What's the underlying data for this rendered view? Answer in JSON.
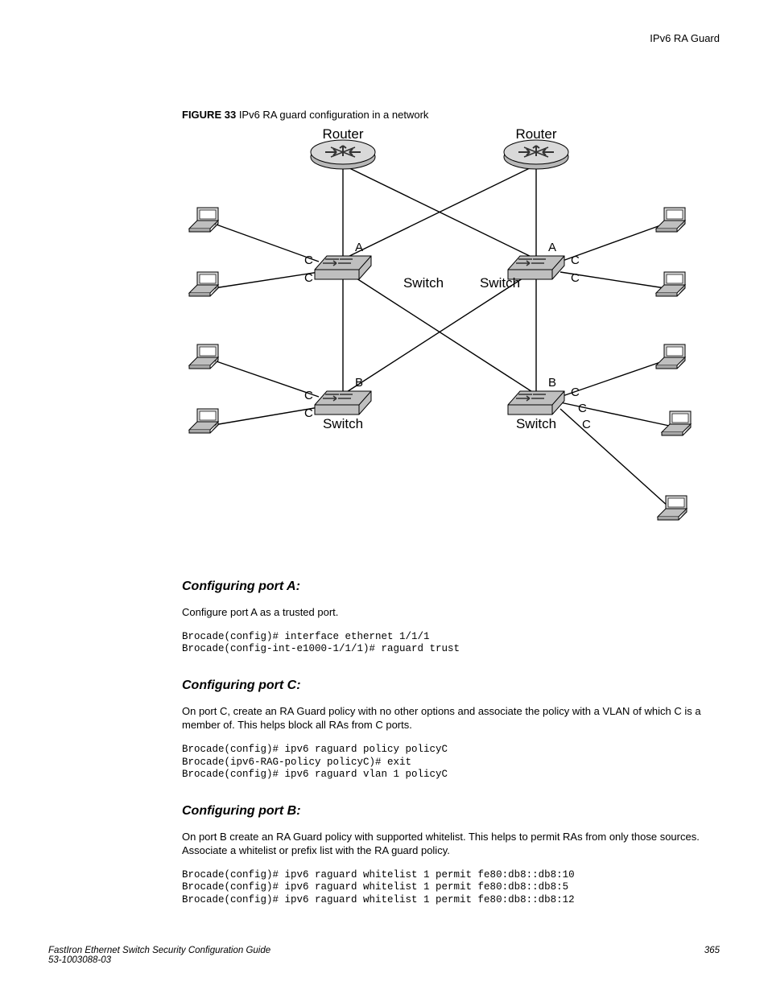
{
  "header": {
    "running": "IPv6 RA Guard"
  },
  "figure": {
    "label": "FIGURE 33",
    "caption": "IPv6 RA guard configuration in a network",
    "labels": {
      "router": "Router",
      "switch": "Switch",
      "portA": "A",
      "portB": "B",
      "portC": "C"
    }
  },
  "sections": {
    "portA": {
      "heading": "Configuring port A:",
      "body": "Configure port A as a trusted port.",
      "code": "Brocade(config)# interface ethernet 1/1/1\nBrocade(config-int-e1000-1/1/1)# raguard trust"
    },
    "portC": {
      "heading": "Configuring port C:",
      "body": "On port C, create an RA Guard policy with no other options and associate the policy with a VLAN of which C is a member of. This helps block all RAs from C ports.",
      "code": "Brocade(config)# ipv6 raguard policy policyC\nBrocade(ipv6-RAG-policy policyC)# exit\nBrocade(config)# ipv6 raguard vlan 1 policyC"
    },
    "portB": {
      "heading": "Configuring port B:",
      "body": "On port B create an RA Guard policy with supported whitelist. This helps to permit RAs from only those sources. Associate a whitelist or prefix list with the RA guard policy.",
      "code": "Brocade(config)# ipv6 raguard whitelist 1 permit fe80:db8::db8:10\nBrocade(config)# ipv6 raguard whitelist 1 permit fe80:db8::db8:5\nBrocade(config)# ipv6 raguard whitelist 1 permit fe80:db8::db8:12"
    }
  },
  "footer": {
    "title": "FastIron Ethernet Switch Security Configuration Guide",
    "partno": "53-1003088-03",
    "page": "365"
  }
}
